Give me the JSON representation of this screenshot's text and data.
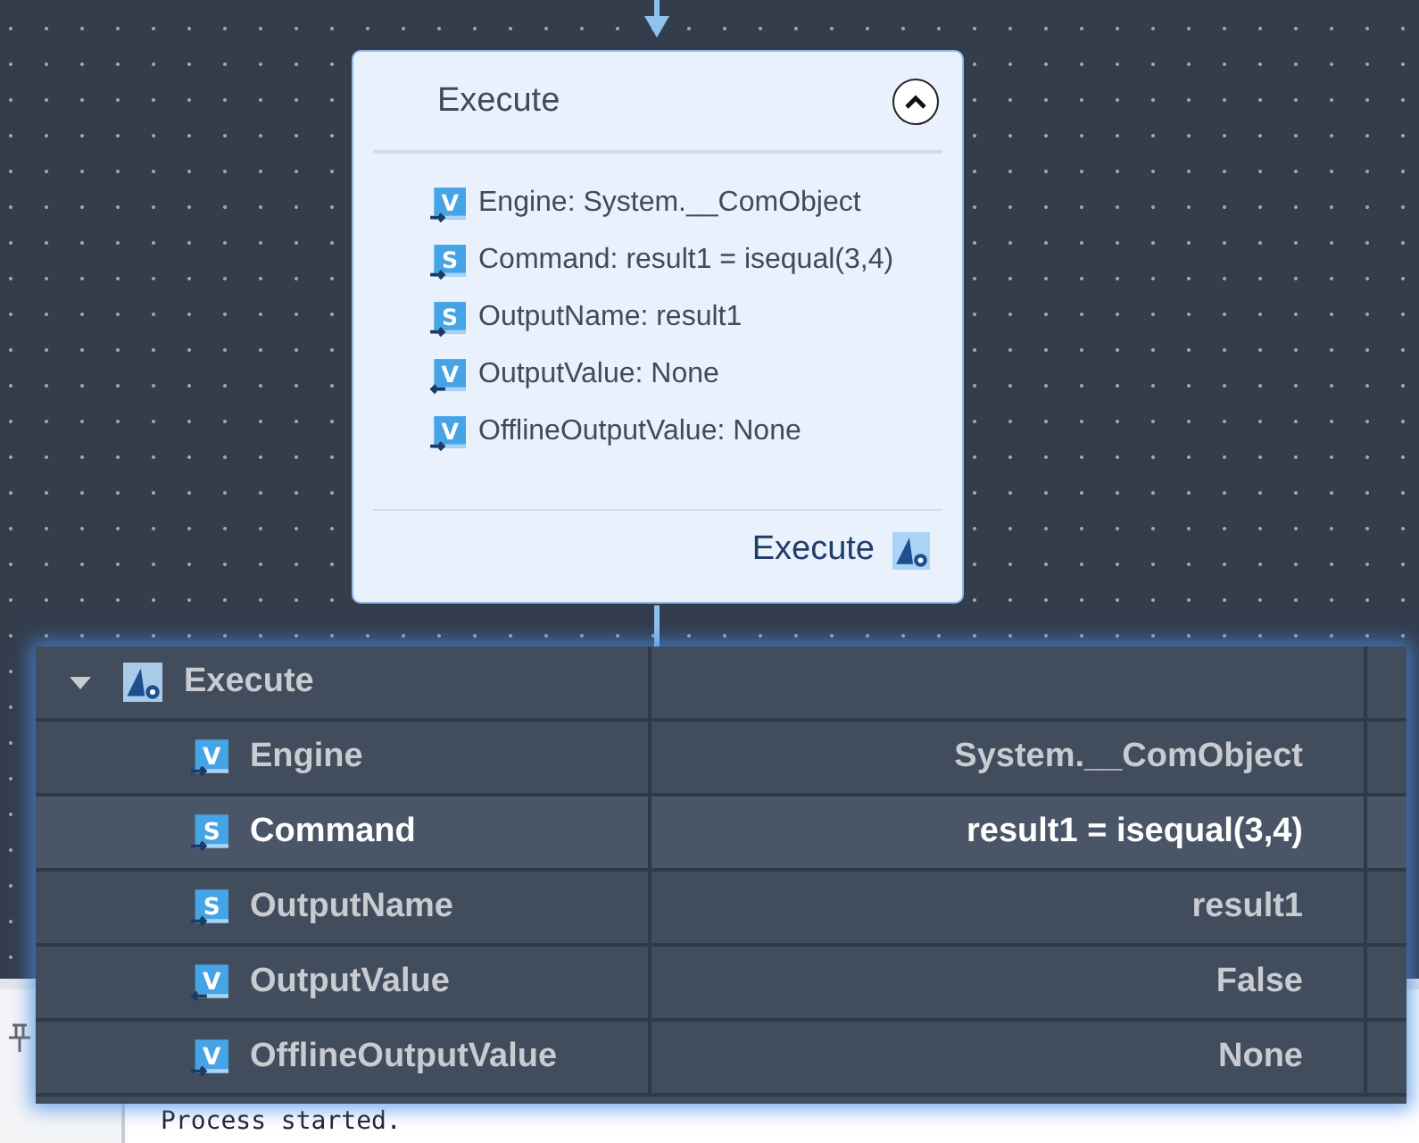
{
  "canvas": {
    "node": {
      "title": "Execute",
      "expanded": true,
      "parameters": [
        {
          "badge": "V",
          "kind": "input",
          "text": "Engine: System.__ComObject"
        },
        {
          "badge": "S",
          "kind": "input",
          "text": "Command: result1 = isequal(3,4)"
        },
        {
          "badge": "S",
          "kind": "input",
          "text": "OutputName: result1"
        },
        {
          "badge": "V",
          "kind": "output",
          "text": "OutputValue: None"
        },
        {
          "badge": "V",
          "kind": "input",
          "text": "OfflineOutputValue: None"
        }
      ],
      "footer": "Execute"
    }
  },
  "property_grid": {
    "root": {
      "label": "Execute",
      "expanded": true
    },
    "rows": [
      {
        "badge": "V",
        "kind": "input",
        "name": "Engine",
        "value": "System.__ComObject",
        "selected": false
      },
      {
        "badge": "S",
        "kind": "input",
        "name": "Command",
        "value": "result1 = isequal(3,4)",
        "selected": true
      },
      {
        "badge": "S",
        "kind": "input",
        "name": "OutputName",
        "value": "result1",
        "selected": false
      },
      {
        "badge": "V",
        "kind": "output",
        "name": "OutputValue",
        "value": "False",
        "selected": false
      },
      {
        "badge": "V",
        "kind": "input",
        "name": "OfflineOutputValue",
        "value": "None",
        "selected": false
      }
    ]
  },
  "console": {
    "text": "Process started."
  }
}
